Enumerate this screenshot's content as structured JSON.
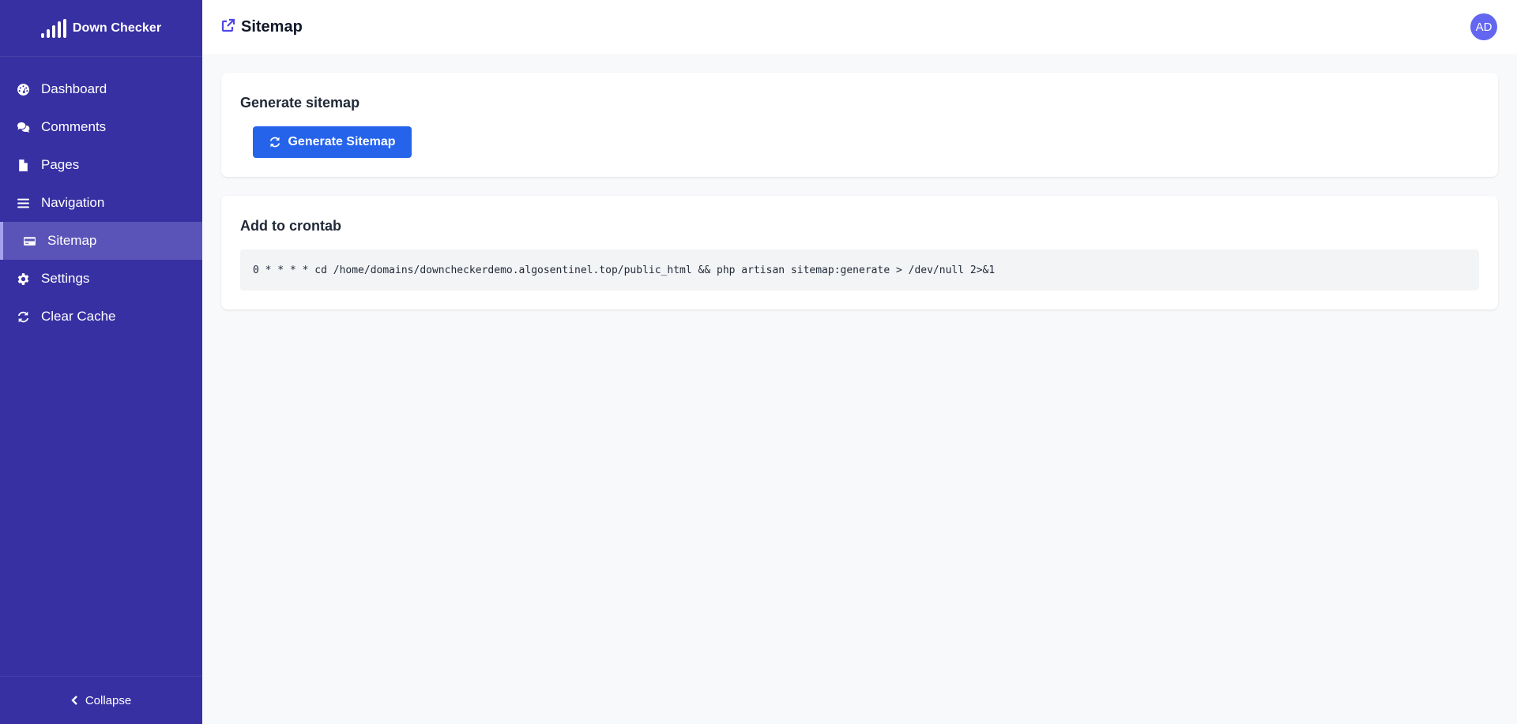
{
  "brand": {
    "name": "Down Checker",
    "icon": "signal-bars-icon"
  },
  "sidebar": {
    "items": [
      {
        "label": "Dashboard",
        "icon": "dashboard-icon"
      },
      {
        "label": "Comments",
        "icon": "comments-icon"
      },
      {
        "label": "Pages",
        "icon": "file-icon"
      },
      {
        "label": "Navigation",
        "icon": "bars-icon"
      },
      {
        "label": "Sitemap",
        "icon": "sitemap-icon",
        "active": true
      },
      {
        "label": "Settings",
        "icon": "gear-icon"
      },
      {
        "label": "Clear Cache",
        "icon": "refresh-icon"
      }
    ],
    "collapse_label": "Collapse"
  },
  "header": {
    "title": "Sitemap",
    "icon": "external-link-icon",
    "avatar_initials": "AD"
  },
  "cards": {
    "generate": {
      "title": "Generate sitemap",
      "button_label": "Generate Sitemap"
    },
    "crontab": {
      "title": "Add to crontab",
      "command": "0 * * * * cd /home/domains/downcheckerdemo.algosentinel.top/public_html && php artisan sitemap:generate > /dev/null 2>&1"
    }
  },
  "colors": {
    "sidebar_bg": "#3730a3",
    "sidebar_active": "#5b54b8",
    "primary_button": "#2563eb",
    "avatar_bg": "#6366f1"
  }
}
